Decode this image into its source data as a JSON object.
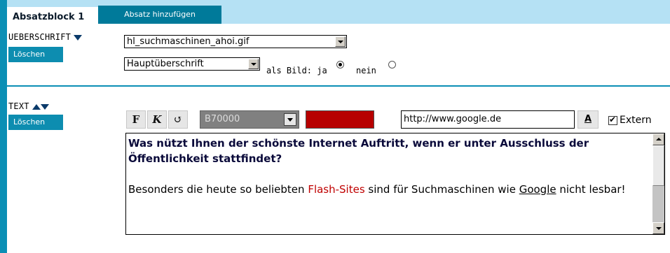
{
  "header": {
    "active_tab": "Absatzblock 1",
    "add_button": "Absatz hinzufügen"
  },
  "heading_section": {
    "label": "UEBERSCHRIFT",
    "delete_button": "Löschen",
    "image_select_value": "hl_suchmaschinen_ahoi.gif",
    "type_select_value": "Hauptüberschrift",
    "as_image_label": "als Bild: ja",
    "no_label": "nein",
    "as_image_selected": "ja"
  },
  "text_section": {
    "label": "TEXT",
    "delete_button": "Löschen",
    "toolbar": {
      "bold_label": "F",
      "italic_label": "K",
      "undo_icon": "undo-icon",
      "color_value": "B70000",
      "color_swatch": "#b70000",
      "url_value": "http://www.google.de",
      "link_label": "A",
      "extern_label": "Extern",
      "extern_checked": true
    },
    "content": {
      "heading_line": "Was nützt Ihnen der schönste Internet Auftritt, wenn er unter Ausschluss der Öffentlichkeit stattfindet?",
      "para_part1": "Besonders die heute so beliebten ",
      "para_red": "Flash-Sites",
      "para_part2": " sind für Suchmaschinen wie ",
      "para_link": "Google",
      "para_part3": " nicht lesbar!"
    }
  },
  "colors": {
    "frame": "#0b8fb5",
    "tab_bar": "#b5e1f4",
    "button": "#0d8db0",
    "accent_red": "#b70000"
  }
}
